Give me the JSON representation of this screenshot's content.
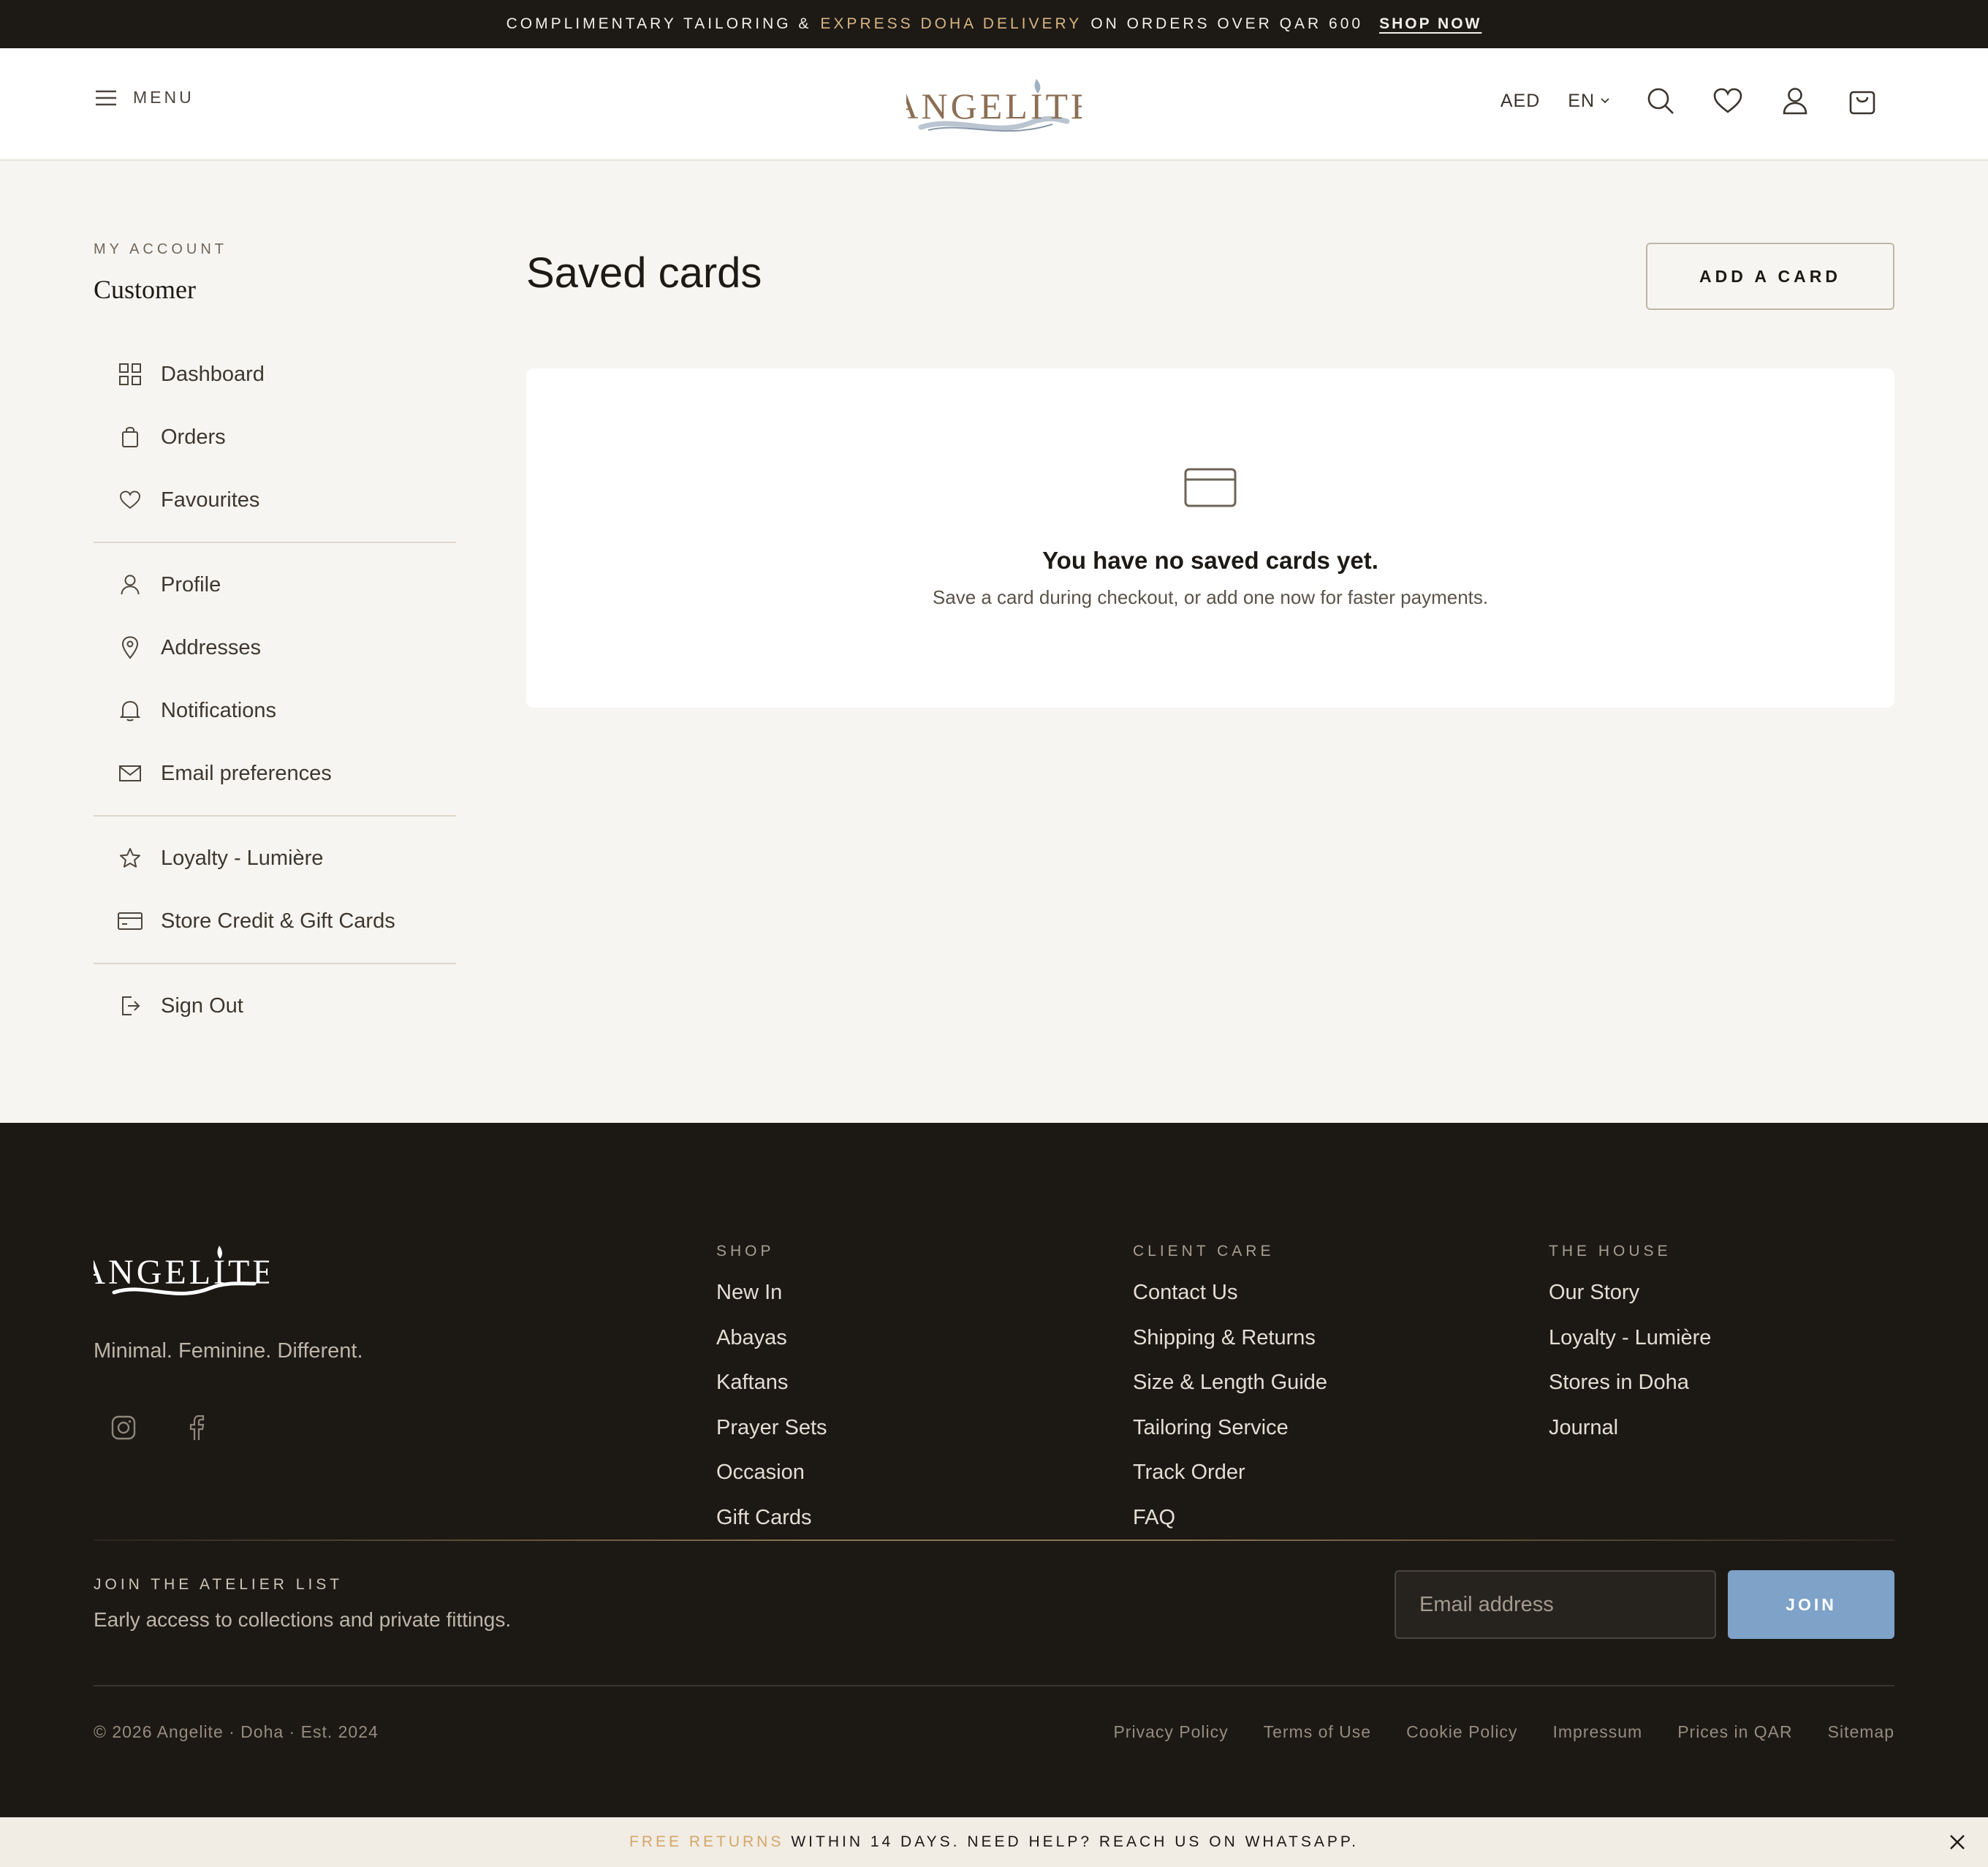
{
  "topbar": {
    "text_before": "COMPLIMENTARY TAILORING &",
    "highlight": "EXPRESS DOHA DELIVERY",
    "text_after": "ON ORDERS OVER QAR 600",
    "cta": "SHOP NOW",
    "highlight_color": "#d8b482"
  },
  "header": {
    "menu_label": "MENU",
    "brand": "ANGELITE",
    "currency": "AED",
    "language": "EN",
    "icons": [
      "search-icon",
      "heart-icon",
      "user-icon",
      "bag-icon"
    ]
  },
  "sidebar": {
    "section_label": "MY ACCOUNT",
    "customer_name": "Customer",
    "items": [
      {
        "label": "Dashboard",
        "icon": "grid-icon"
      },
      {
        "label": "Orders",
        "icon": "bag-icon"
      },
      {
        "label": "Favourites",
        "icon": "heart-icon"
      },
      {
        "label": "Profile",
        "icon": "user-icon"
      },
      {
        "label": "Addresses",
        "icon": "pin-icon"
      },
      {
        "label": "Notifications",
        "icon": "bell-icon"
      },
      {
        "label": "Email preferences",
        "icon": "mail-icon"
      },
      {
        "label": "Loyalty - Lumière",
        "icon": "star-icon"
      },
      {
        "label": "Store Credit & Gift Cards",
        "icon": "card-icon"
      },
      {
        "label": "Sign Out",
        "icon": "signout-icon"
      }
    ]
  },
  "main": {
    "title": "Saved cards",
    "add_button": "ADD A CARD",
    "empty_title": "You have no saved cards yet.",
    "empty_subtitle": "Save a card during checkout, or add one now for faster payments."
  },
  "footer": {
    "brand": "ANGELITE",
    "tagline": "Minimal. Feminine. Different.",
    "social": [
      "instagram-icon",
      "facebook-icon"
    ],
    "columns": [
      {
        "heading": "SHOP",
        "links": [
          "New In",
          "Abayas",
          "Kaftans",
          "Prayer Sets",
          "Occasion",
          "Gift Cards"
        ]
      },
      {
        "heading": "CLIENT CARE",
        "links": [
          "Contact Us",
          "Shipping & Returns",
          "Size & Length Guide",
          "Tailoring Service",
          "Track Order",
          "FAQ"
        ]
      },
      {
        "heading": "THE HOUSE",
        "links": [
          "Our Story",
          "Loyalty - Lumière",
          "Stores in Doha",
          "Journal"
        ]
      }
    ],
    "newsletter": {
      "label": "JOIN THE ATELIER LIST",
      "subtitle": "Early access to collections and private fittings.",
      "placeholder": "Email address",
      "button": "JOIN",
      "button_color": "#7ea2c8"
    },
    "copyright": "© 2026 Angelite · Doha · Est. 2024",
    "legal": [
      "Privacy Policy",
      "Terms of Use",
      "Cookie Policy",
      "Impressum",
      "Prices in QAR",
      "Sitemap"
    ]
  },
  "bottombar": {
    "highlight": "FREE RETURNS",
    "text": "WITHIN 14 DAYS. NEED HELP? REACH US ON WHATSAPP.",
    "highlight_color": "#d3a76a"
  }
}
